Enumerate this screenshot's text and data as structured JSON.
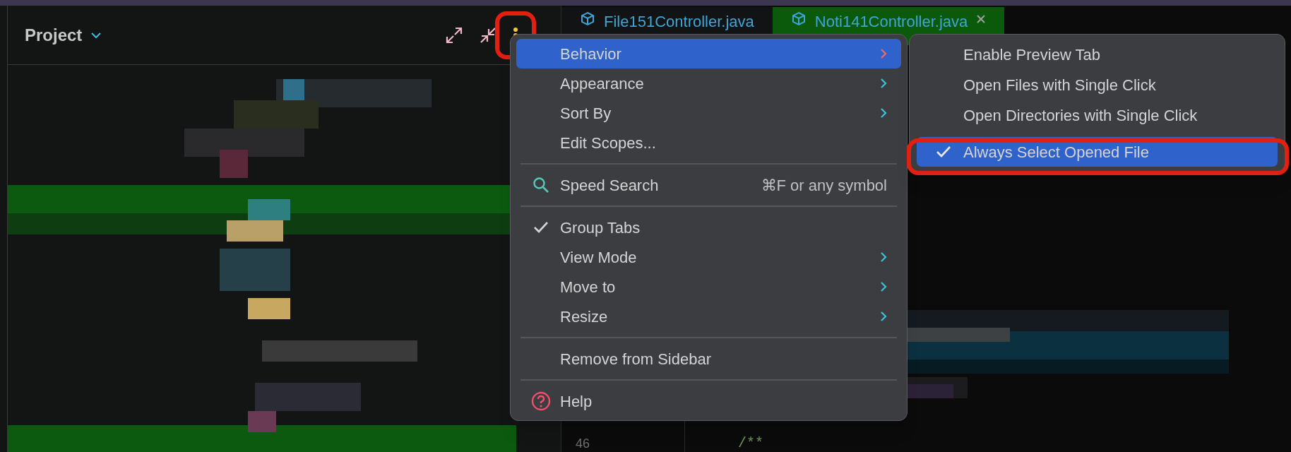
{
  "project_panel": {
    "title": "Project",
    "toolbar": [
      {
        "kind": "expand"
      },
      {
        "kind": "collapse"
      },
      {
        "kind": "options",
        "circled": true
      }
    ]
  },
  "editor": {
    "tabs": [
      {
        "label": "File151Controller.java",
        "selected": false,
        "closable": false
      },
      {
        "label": "Noti141Controller.java",
        "selected": true,
        "closable": true
      }
    ],
    "line_number": "46",
    "code_line": "/**"
  },
  "context_menu": {
    "items": [
      {
        "kind": "item",
        "label": "Behavior",
        "submenu": true,
        "selected": true
      },
      {
        "kind": "item",
        "label": "Appearance",
        "submenu": true,
        "selected": false
      },
      {
        "kind": "item",
        "label": "Sort By",
        "submenu": true,
        "selected": false
      },
      {
        "kind": "item",
        "label": "Edit Scopes...",
        "submenu": false,
        "selected": false
      },
      {
        "kind": "separator"
      },
      {
        "kind": "search",
        "label": "Speed Search",
        "shortcut": "⌘F or any symbol",
        "submenu": false,
        "selected": false
      },
      {
        "kind": "separator"
      },
      {
        "kind": "item",
        "label": "Group Tabs",
        "checked": true,
        "submenu": false,
        "selected": false
      },
      {
        "kind": "item",
        "label": "View Mode",
        "submenu": true,
        "selected": false
      },
      {
        "kind": "item",
        "label": "Move to",
        "submenu": true,
        "selected": false
      },
      {
        "kind": "item",
        "label": "Resize",
        "submenu": true,
        "selected": false
      },
      {
        "kind": "separator"
      },
      {
        "kind": "item",
        "label": "Remove from Sidebar",
        "submenu": false,
        "selected": false
      },
      {
        "kind": "separator"
      },
      {
        "kind": "help",
        "label": "Help",
        "submenu": false,
        "selected": false
      }
    ]
  },
  "behavior_submenu": {
    "items": [
      {
        "label": "Enable Preview Tab",
        "checked": false,
        "selected": false,
        "circled": false
      },
      {
        "label": "Open Files with Single Click",
        "checked": false,
        "selected": false,
        "circled": false
      },
      {
        "label": "Open Directories with Single Click",
        "checked": false,
        "selected": false,
        "circled": false
      },
      {
        "label": "Always Select Opened File",
        "checked": true,
        "selected": true,
        "circled": true
      }
    ]
  }
}
